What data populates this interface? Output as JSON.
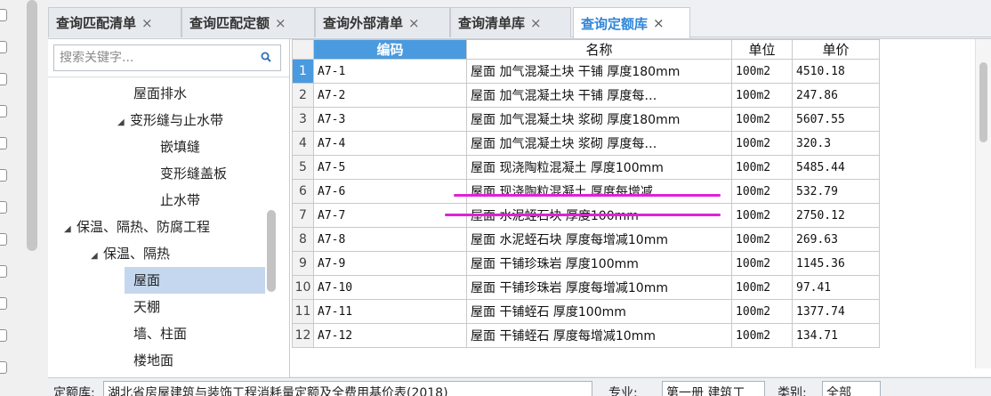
{
  "tabs": [
    {
      "label": "查询匹配清单",
      "close": "×"
    },
    {
      "label": "查询匹配定额",
      "close": "×"
    },
    {
      "label": "查询外部清单",
      "close": "×"
    },
    {
      "label": "查询清单库",
      "close": "×"
    },
    {
      "label": "查询定额库",
      "close": "×",
      "active": true
    }
  ],
  "search": {
    "placeholder": "搜索关键字...",
    "icon": "search-icon"
  },
  "tree": [
    {
      "label": "屋面排水",
      "arrow": ""
    },
    {
      "label": "变形缝与止水带",
      "arrow": "◢"
    },
    {
      "label": "嵌填缝",
      "arrow": ""
    },
    {
      "label": "变形缝盖板",
      "arrow": ""
    },
    {
      "label": "止水带",
      "arrow": ""
    },
    {
      "label": "保温、隔热、防腐工程",
      "arrow": "◢"
    },
    {
      "label": "保温、隔热",
      "arrow": "◢"
    },
    {
      "label": "屋面",
      "arrow": "",
      "selected": true
    },
    {
      "label": "天棚",
      "arrow": ""
    },
    {
      "label": "墙、柱面",
      "arrow": ""
    },
    {
      "label": "楼地面",
      "arrow": ""
    }
  ],
  "table": {
    "headers": {
      "code": "编码",
      "name": "名称",
      "unit": "单位",
      "price": "单价"
    },
    "rows": [
      {
        "n": "1",
        "code": "A7-1",
        "name": "屋面 加气混凝土块 干铺 厚度180mm",
        "unit": "100m2",
        "price": "4510.18"
      },
      {
        "n": "2",
        "code": "A7-2",
        "name": "屋面 加气混凝土块 干铺 厚度每…",
        "unit": "100m2",
        "price": "247.86"
      },
      {
        "n": "3",
        "code": "A7-3",
        "name": "屋面 加气混凝土块 浆砌 厚度180mm",
        "unit": "100m2",
        "price": "5607.55"
      },
      {
        "n": "4",
        "code": "A7-4",
        "name": "屋面 加气混凝土块 浆砌 厚度每…",
        "unit": "100m2",
        "price": "320.3"
      },
      {
        "n": "5",
        "code": "A7-5",
        "name": "屋面 现浇陶粒混凝土 厚度100mm",
        "unit": "100m2",
        "price": "5485.44"
      },
      {
        "n": "6",
        "code": "A7-6",
        "name": "屋面 现浇陶粒混凝土 厚度每增减…",
        "unit": "100m2",
        "price": "532.79"
      },
      {
        "n": "7",
        "code": "A7-7",
        "name": "屋面 水泥蛭石块 厚度100mm",
        "unit": "100m2",
        "price": "2750.12"
      },
      {
        "n": "8",
        "code": "A7-8",
        "name": "屋面 水泥蛭石块 厚度每增减10mm",
        "unit": "100m2",
        "price": "269.63"
      },
      {
        "n": "9",
        "code": "A7-9",
        "name": "屋面 干铺珍珠岩 厚度100mm",
        "unit": "100m2",
        "price": "1145.36"
      },
      {
        "n": "10",
        "code": "A7-10",
        "name": "屋面 干铺珍珠岩 厚度每增减10mm",
        "unit": "100m2",
        "price": "97.41"
      },
      {
        "n": "11",
        "code": "A7-11",
        "name": "屋面 干铺蛭石 厚度100mm",
        "unit": "100m2",
        "price": "1377.74"
      },
      {
        "n": "12",
        "code": "A7-12",
        "name": "屋面 干铺蛭石 厚度每增减10mm",
        "unit": "100m2",
        "price": "134.71"
      }
    ]
  },
  "bottom": {
    "lib_label": "定额库:",
    "lib_value": "湖北省房屋建筑与装饰工程消耗量定额及全费用基价表(2018)",
    "major_label": "专业:",
    "major_value": "第一册 建筑工",
    "category_label": "类别:",
    "category_value": "全部"
  },
  "colors": {
    "accent": "#4a9ae0",
    "annotation": "#e020d8",
    "selected_tree": "#c5d7ee"
  }
}
